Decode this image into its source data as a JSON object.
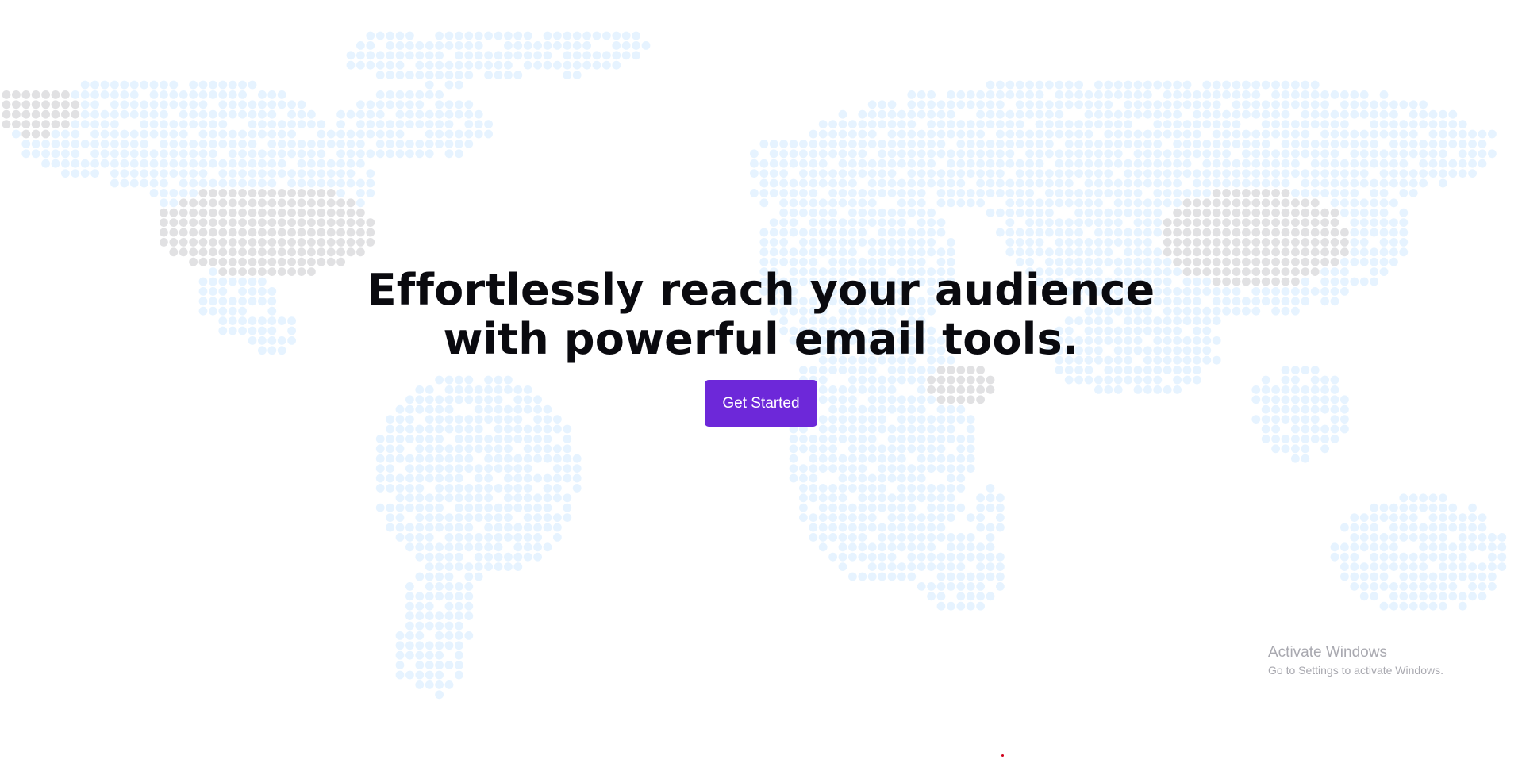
{
  "hero": {
    "title_line1": "Effortlessly reach your audience",
    "title_line2": "with powerful email tools.",
    "cta_label": "Get Started"
  },
  "watermark": {
    "title": "Activate Windows",
    "subtitle": "Go to Settings to activate Windows."
  },
  "colors": {
    "accent": "#6d28d9",
    "map_dot": "#e6f3ff",
    "map_dot_highlight": "#e1e1e3",
    "heading": "#0a0a0f"
  },
  "map": {
    "style": "dotted-world-map",
    "highlighted_regions": [
      "Alaska",
      "United States",
      "China",
      "Horn of Africa"
    ]
  }
}
